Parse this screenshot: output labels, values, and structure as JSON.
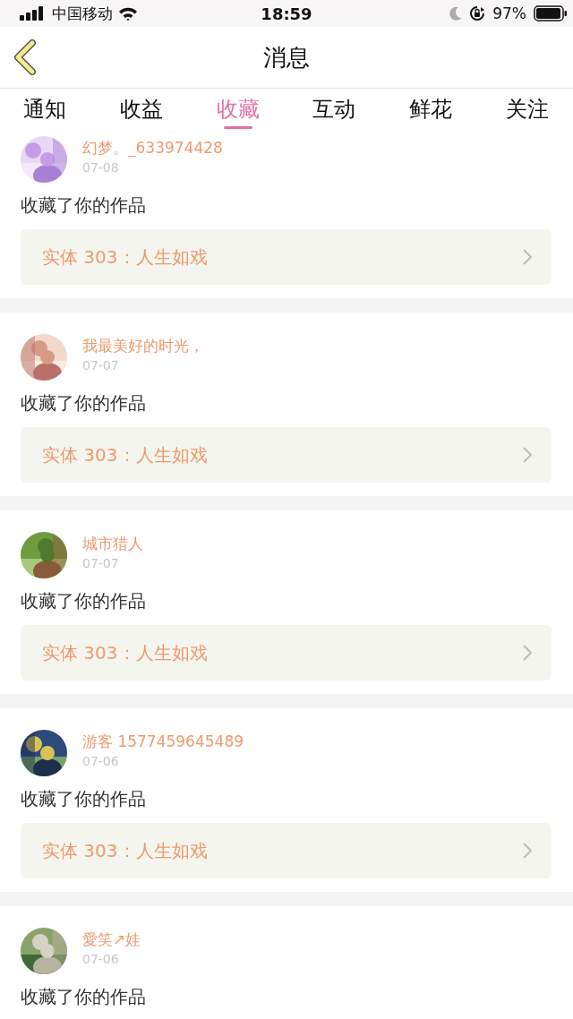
{
  "status_bar": {
    "carrier": "中国移动",
    "time": "18:59",
    "battery": "97%"
  },
  "nav": {
    "title": "消息"
  },
  "tabs": [
    {
      "label": "通知",
      "selected": false
    },
    {
      "label": "收益",
      "selected": false
    },
    {
      "label": "收藏",
      "selected": true
    },
    {
      "label": "互动",
      "selected": false
    },
    {
      "label": "鲜花",
      "selected": false
    },
    {
      "label": "关注",
      "selected": false
    }
  ],
  "messages": [
    {
      "user": "幻梦。_633974428",
      "date": "07-08",
      "action": "收藏了你的作品",
      "work": "实体 303：人生如戏"
    },
    {
      "user": "我最美好的时光，",
      "date": "07-07",
      "action": "收藏了你的作品",
      "work": "实体 303：人生如戏"
    },
    {
      "user": "城市猎人",
      "date": "07-07",
      "action": "收藏了你的作品",
      "work": "实体 303：人生如戏"
    },
    {
      "user": "游客 1577459645489",
      "date": "07-06",
      "action": "收藏了你的作品",
      "work": "实体 303：人生如戏"
    },
    {
      "user": "愛笑↗娃",
      "date": "07-06",
      "action": "收藏了你的作品"
    }
  ]
}
